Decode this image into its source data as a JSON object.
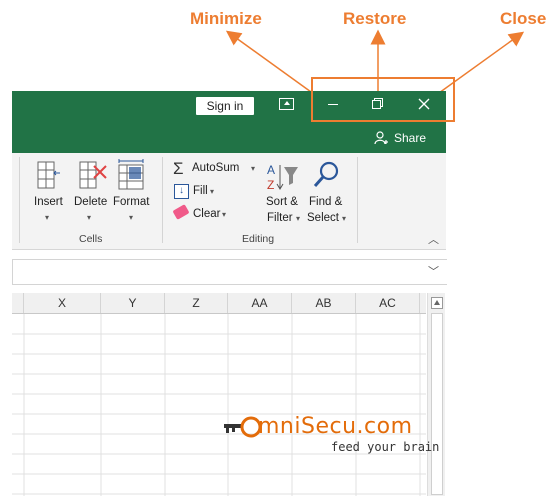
{
  "callouts": {
    "minimize": "Minimize",
    "restore": "Restore",
    "close": "Close"
  },
  "titlebar": {
    "signin_label": "Sign in",
    "share_label": "Share"
  },
  "ribbon": {
    "cells_group": {
      "label": "Cells",
      "insert": "Insert",
      "delete": "Delete",
      "format": "Format"
    },
    "editing_group": {
      "label": "Editing",
      "autosum": "AutoSum",
      "fill": "Fill",
      "clear": "Clear",
      "sort_filter_line1": "Sort &",
      "sort_filter_line2": "Filter",
      "find_select_line1": "Find &",
      "find_select_line2": "Select"
    }
  },
  "grid": {
    "columns": [
      "X",
      "Y",
      "Z",
      "AA",
      "AB",
      "AC"
    ]
  },
  "watermark": {
    "brand": "mniSecu.com",
    "tagline": "feed your brain"
  },
  "colors": {
    "accent": "#ed7d31",
    "excel_green": "#217346"
  }
}
